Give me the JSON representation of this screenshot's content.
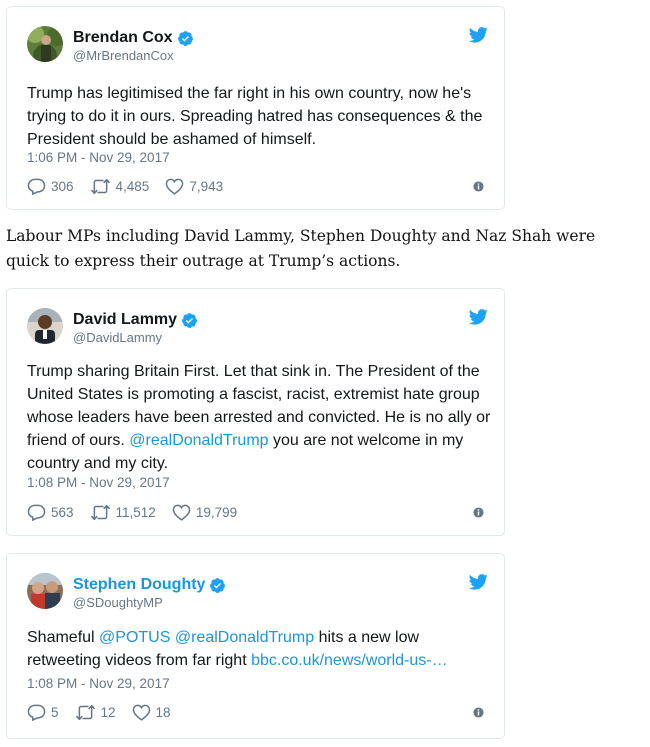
{
  "tweets": [
    {
      "name": "Brendan Cox",
      "handle": "@MrBrendanCox",
      "text": "Trump has legitimised the far right in his own country, now he's trying to do it in ours. Spreading hatred has consequences & the President should be ashamed of himself.",
      "time": "1:06 PM - Nov 29, 2017",
      "replies": "306",
      "retweets": "4,485",
      "likes": "7,943"
    },
    {
      "name": "David Lammy",
      "handle": "@DavidLammy",
      "text_before": "Trump sharing Britain First. Let that sink in. The President of the United States is promoting a fascist, racist, extremist hate group whose leaders have been arrested and convicted. He is no ally or friend of ours. ",
      "mention": "@realDonaldTrump",
      "text_after": " you are not welcome in my country and my city.",
      "time": "1:08 PM - Nov 29, 2017",
      "replies": "563",
      "retweets": "11,512",
      "likes": "19,799"
    },
    {
      "name": "Stephen Doughty",
      "handle": "@SDoughtyMP",
      "text_start": "Shameful ",
      "mention1": "@POTUS",
      "space": " ",
      "mention2": "@realDonaldTrump",
      "text_mid": " hits a new low retweeting videos from far right ",
      "link": "bbc.co.uk/news/world-us-…",
      "time": "1:08 PM - Nov 29, 2017",
      "replies": "5",
      "retweets": "12",
      "likes": "18"
    }
  ],
  "prose": "Labour MPs including David Lammy, Stephen Doughty and Naz Shah were quick to express their outrage at Trump’s actions.",
  "colors": {
    "link": "#1b95e0",
    "twitter_blue": "#1da1f2",
    "meta": "#657786"
  },
  "icons": [
    "verified-badge-icon",
    "twitter-bird-icon",
    "reply-icon",
    "retweet-icon",
    "like-heart-icon",
    "info-icon"
  ]
}
